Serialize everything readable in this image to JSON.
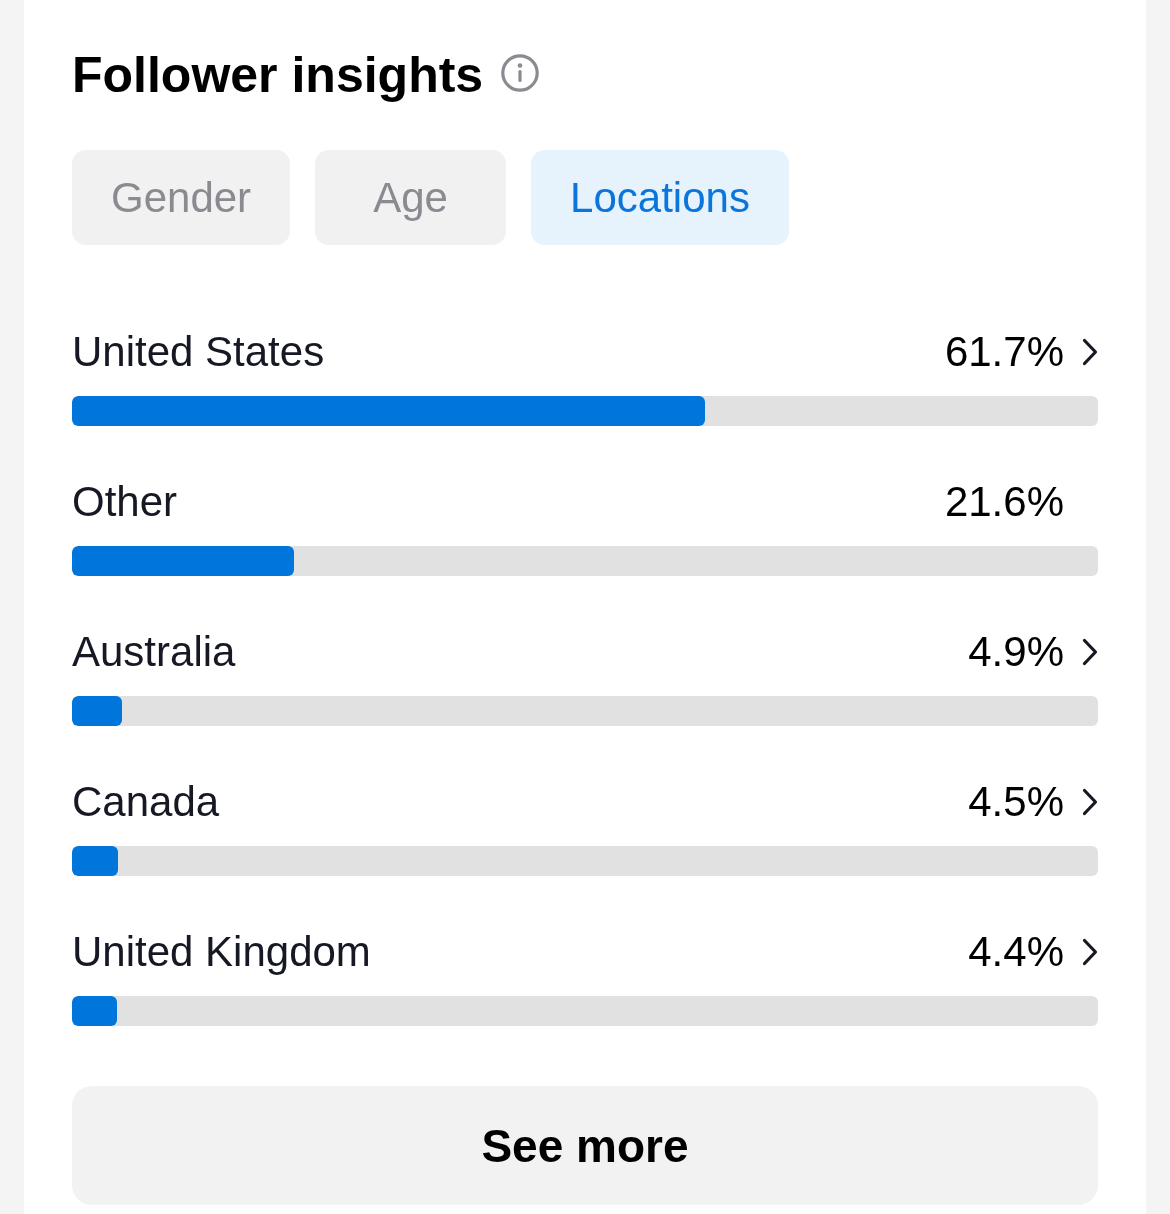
{
  "card": {
    "title": "Follower insights"
  },
  "tabs": [
    {
      "label": "Gender",
      "selected": false
    },
    {
      "label": "Age",
      "selected": false
    },
    {
      "label": "Locations",
      "selected": true
    }
  ],
  "locations": [
    {
      "name": "United States",
      "percent": "61.7%",
      "level": 0.617,
      "has_details": true
    },
    {
      "name": "Other",
      "percent": "21.6%",
      "level": 0.216,
      "has_details": false
    },
    {
      "name": "Australia",
      "percent": "4.9%",
      "level": 0.049,
      "has_details": true
    },
    {
      "name": "Canada",
      "percent": "4.5%",
      "level": 0.045,
      "has_details": true
    },
    {
      "name": "United Kingdom",
      "percent": "4.4%",
      "level": 0.044,
      "has_details": true
    }
  ],
  "see_more_button": {
    "label": "See more"
  }
}
